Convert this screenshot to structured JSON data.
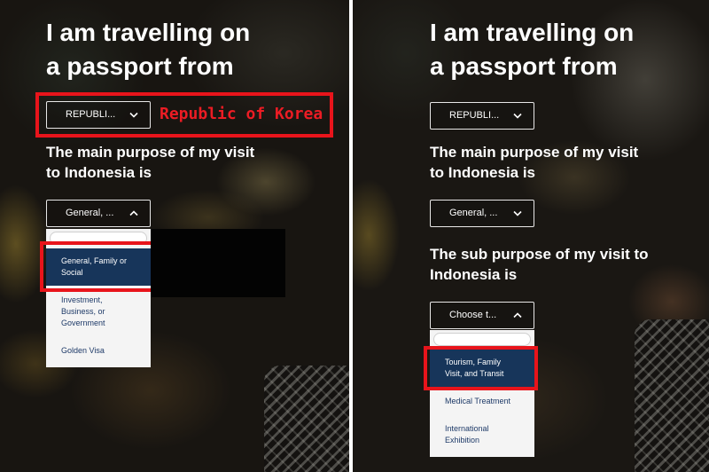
{
  "left_panel": {
    "heading": {
      "line1": "I am travelling on",
      "line2": "a passport from"
    },
    "passport_select": {
      "value": "REPUBLI..."
    },
    "annotation": {
      "text": "Republic of Korea"
    },
    "purpose_label": {
      "line1": "The main purpose of my visit",
      "line2": "to Indonesia is"
    },
    "purpose_select": {
      "value": "General, ..."
    },
    "purpose_options": [
      {
        "label": "General, Family or Social",
        "selected": true
      },
      {
        "label": "Investment, Business, or Government",
        "selected": false
      },
      {
        "label": "Golden Visa",
        "selected": false
      }
    ]
  },
  "right_panel": {
    "heading": {
      "line1": "I am travelling on",
      "line2": "a passport from"
    },
    "passport_select": {
      "value": "REPUBLI..."
    },
    "purpose_label": {
      "line1": "The main purpose of my visit",
      "line2": "to Indonesia is"
    },
    "purpose_select": {
      "value": "General, ..."
    },
    "sub_purpose_label": {
      "line1": "The sub purpose of my visit to",
      "line2": "Indonesia is"
    },
    "sub_purpose_select": {
      "value": "Choose t..."
    },
    "sub_purpose_options": [
      {
        "label": "Tourism, Family Visit, and Transit",
        "selected": true
      },
      {
        "label": "Medical Treatment",
        "selected": false
      },
      {
        "label": "International Exhibition",
        "selected": false
      }
    ]
  },
  "icons": {
    "closed_select": "chevron-down-icon",
    "open_select": "chevron-up-icon"
  },
  "colors": {
    "highlight_red": "#e8141b",
    "selected_option_bg": "#17355a",
    "option_text": "#1e3a68",
    "text": "#ffffff"
  }
}
